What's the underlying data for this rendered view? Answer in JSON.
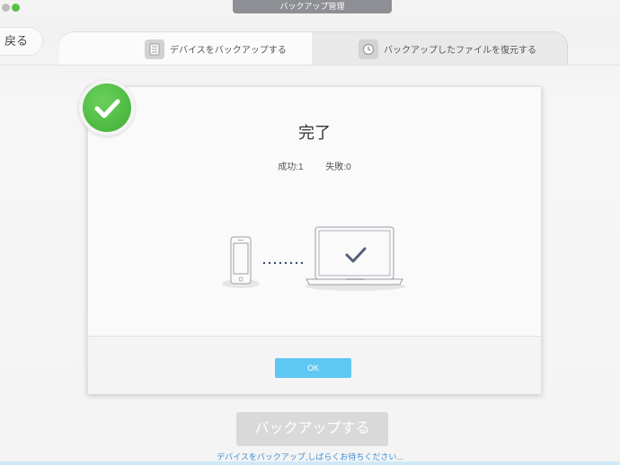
{
  "window": {
    "title": "バックアップ管理"
  },
  "nav": {
    "back_label": "戻る"
  },
  "tabs": [
    {
      "label": "デバイスをバックアップする",
      "icon": "document-icon",
      "active": true
    },
    {
      "label": "バックアップしたファイルを復元する",
      "icon": "restore-clock-icon",
      "active": false
    }
  ],
  "dialog": {
    "title": "完了",
    "success_label": "成功:1",
    "fail_label": "失敗:0",
    "ok_label": "OK",
    "badge_icon": "success-check-icon"
  },
  "footer": {
    "backup_button": "バックアップする",
    "status": "デバイスをバックアップ,しばらくお待ちください..."
  },
  "colors": {
    "accent": "#5fc8f2",
    "success": "#4cbb3f",
    "status_text": "#3b8fd9"
  }
}
